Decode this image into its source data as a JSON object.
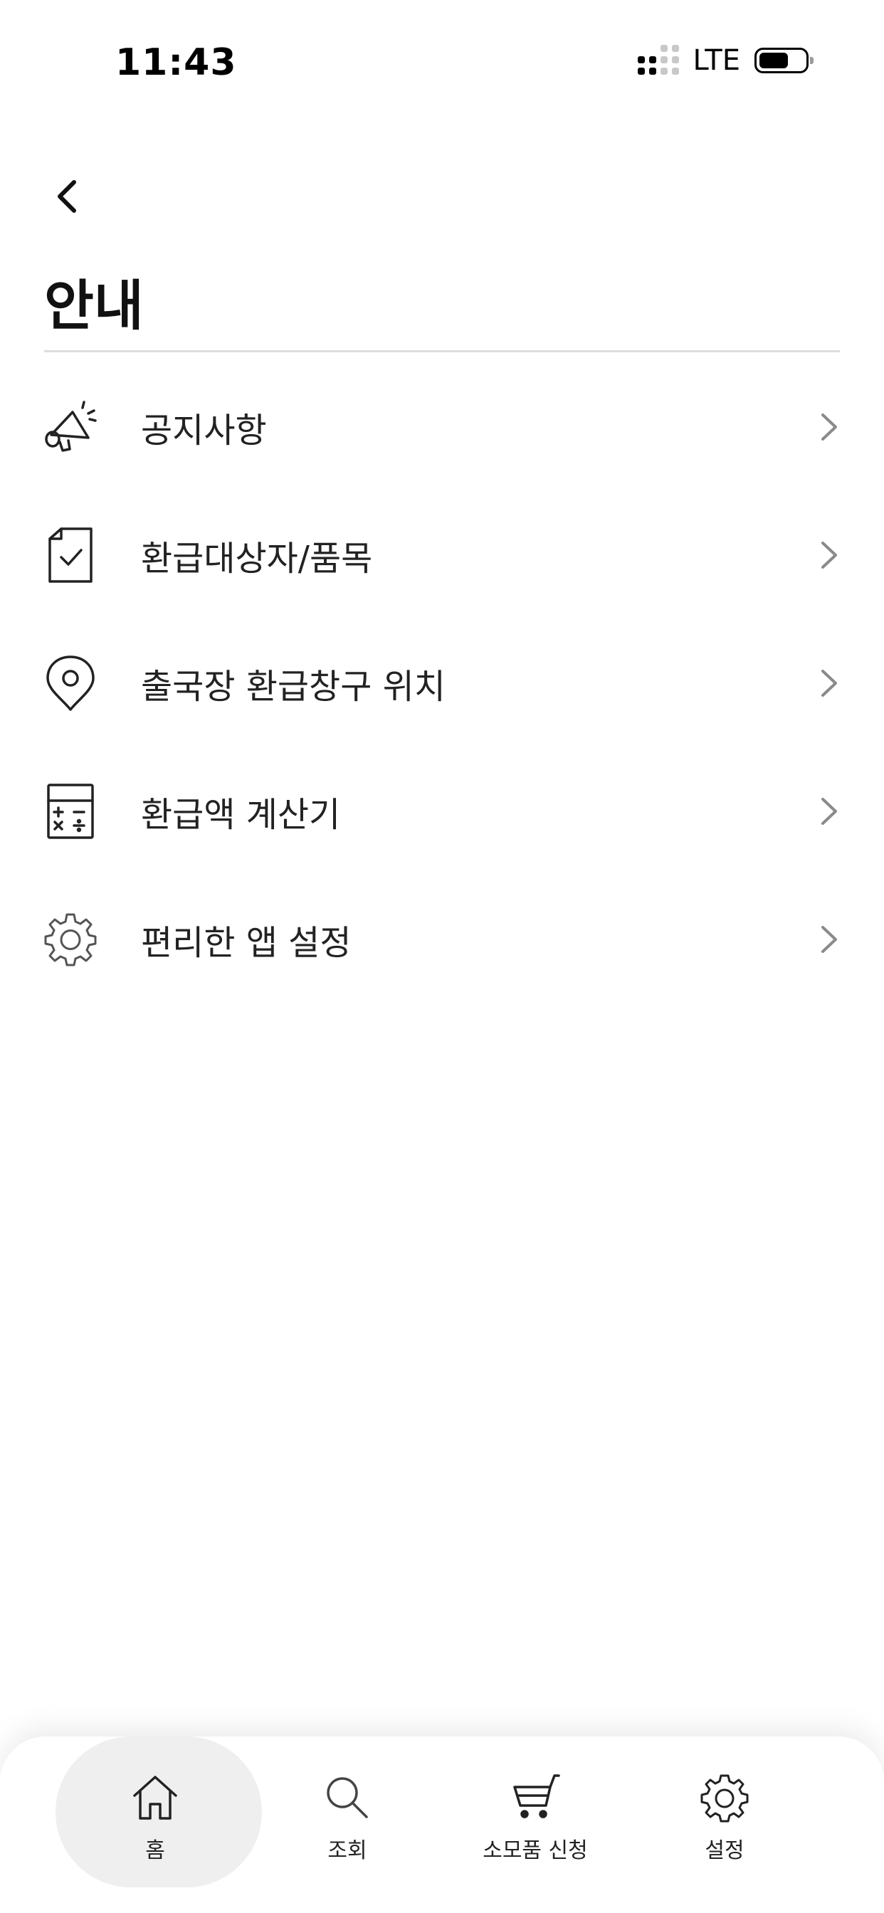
{
  "status_bar": {
    "time": "11:43",
    "network": "LTE"
  },
  "header": {
    "back_icon": "chevron-left-icon",
    "title": "안내"
  },
  "menu": {
    "items": [
      {
        "label": "공지사항",
        "icon": "megaphone-icon"
      },
      {
        "label": "환급대상자/품목",
        "icon": "document-check-icon"
      },
      {
        "label": "출국장 환급창구 위치",
        "icon": "location-pin-icon"
      },
      {
        "label": "환급액 계산기",
        "icon": "calculator-icon"
      },
      {
        "label": "편리한 앱 설정",
        "icon": "gear-icon"
      }
    ]
  },
  "bottom_nav": {
    "active": "home",
    "items": [
      {
        "label": "홈",
        "icon": "home-icon"
      },
      {
        "label": "조회",
        "icon": "search-icon"
      },
      {
        "label": "소모품 신청",
        "icon": "cart-icon"
      },
      {
        "label": "설정",
        "icon": "gear-icon"
      }
    ]
  },
  "colors": {
    "text": "#222222",
    "icon": "#222222",
    "chevron": "#8a8a8a",
    "divider": "#dcdcdc",
    "active_nav_bg": "#efefef"
  }
}
